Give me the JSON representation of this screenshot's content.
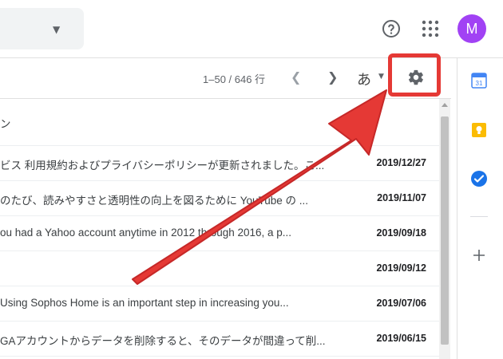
{
  "header": {
    "help_icon": "help-circle-icon",
    "apps_icon": "apps-grid-icon",
    "avatar_letter": "M",
    "avatar_color": "#a142f4"
  },
  "toolbar": {
    "pagination": "1–50 / 646 行",
    "prev_icon": "chevron-left-icon",
    "next_icon": "chevron-right-icon",
    "input_tool_label": "あ",
    "settings_icon": "gear-icon",
    "highlight_color": "#e53935"
  },
  "emails": [
    {
      "subject": "ン",
      "date": ""
    },
    {
      "subject": "ビス 利用規約およびプライバシーポリシーが更新されました。こ...",
      "date": "2019/12/27"
    },
    {
      "subject": "のたび、読みやすさと透明性の向上を図るために YouTube の ...",
      "date": "2019/11/07"
    },
    {
      "subject": "ou had a Yahoo account anytime in 2012 through 2016, a p...",
      "date": "2019/09/18"
    },
    {
      "subject": "",
      "date": "2019/09/12"
    },
    {
      "subject": "Using Sophos Home is an important step in increasing you...",
      "date": "2019/07/06"
    },
    {
      "subject": "GAアカウントからデータを削除すると、そのデータが間違って削...",
      "date": "2019/06/15"
    }
  ],
  "side_panel": {
    "calendar_icon": "calendar-icon",
    "calendar_day": "31",
    "keep_icon": "keep-bulb-icon",
    "tasks_icon": "tasks-check-icon",
    "add_icon": "plus-icon"
  },
  "annotation": {
    "arrow_color": "#e53935",
    "arrow_icon": "red-arrow-pointer"
  }
}
